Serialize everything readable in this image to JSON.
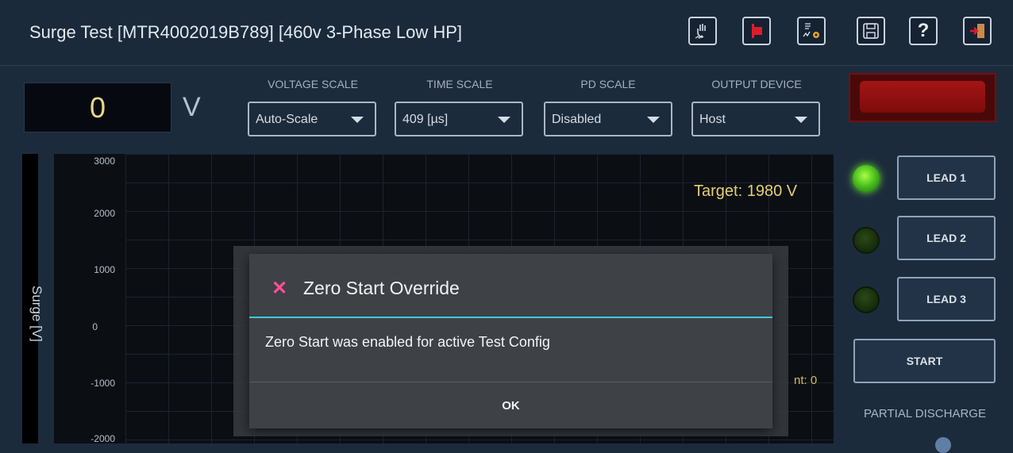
{
  "header": {
    "title": "Surge Test  [MTR4002019B789] [460v 3-Phase Low HP]",
    "icons": [
      "hand-waveform-icon",
      "lead-marker-icon",
      "waveform-settings-icon",
      "save-icon",
      "help-icon",
      "exit-icon"
    ]
  },
  "readout": {
    "voltage": "0",
    "unit": "V"
  },
  "controls": {
    "voltage_scale": {
      "label": "VOLTAGE SCALE",
      "value": "Auto-Scale"
    },
    "time_scale": {
      "label": "TIME SCALE",
      "value": "409 [µs]"
    },
    "pd_scale": {
      "label": "PD SCALE",
      "value": "Disabled"
    },
    "output_device": {
      "label": "OUTPUT DEVICE",
      "value": "Host"
    }
  },
  "plot": {
    "y_ticks": [
      "3000",
      "2000",
      "1000",
      "0",
      "-1000",
      "-2000"
    ],
    "y_label": "Surge [V]",
    "target": "Target: 1980 V",
    "count_fragment": "nt: 0"
  },
  "leads": {
    "lead1": {
      "label": "LEAD 1",
      "state": "on"
    },
    "lead2": {
      "label": "LEAD 2",
      "state": "off"
    },
    "lead3": {
      "label": "LEAD 3",
      "state": "off"
    }
  },
  "actions": {
    "start": "START",
    "partial_discharge": "PARTIAL DISCHARGE"
  },
  "dialog": {
    "title": "Zero Start Override",
    "close_glyph": "✕",
    "message": "Zero Start was enabled for active Test Config",
    "ok": "OK"
  },
  "colors": {
    "accent": "#3fc9d9",
    "target_text": "#e6cf73",
    "alarm_red": "#a31515",
    "led_on": "#3fb51b"
  }
}
